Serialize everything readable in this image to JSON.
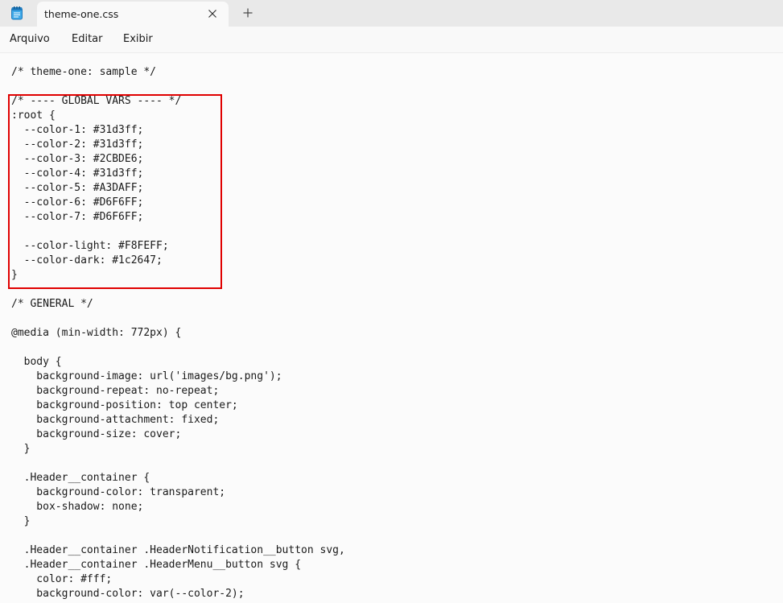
{
  "tab": {
    "title": "theme-one.css",
    "close_icon": "close-icon",
    "new_tab_icon": "plus-icon"
  },
  "app_icon": "notepad-icon",
  "menu": {
    "items": [
      "Arquivo",
      "Editar",
      "Exibir"
    ]
  },
  "highlight": {
    "color": "#e00000"
  },
  "code": {
    "lines": [
      "/* theme-one: sample */",
      "",
      "/* ---- GLOBAL VARS ---- */",
      ":root {",
      "  --color-1: #31d3ff;",
      "  --color-2: #31d3ff;",
      "  --color-3: #2CBDE6;",
      "  --color-4: #31d3ff;",
      "  --color-5: #A3DAFF;",
      "  --color-6: #D6F6FF;",
      "  --color-7: #D6F6FF;",
      "",
      "  --color-light: #F8FEFF;",
      "  --color-dark: #1c2647;",
      "}",
      "",
      "/* GENERAL */",
      "",
      "@media (min-width: 772px) {",
      "",
      "  body {",
      "    background-image: url('images/bg.png');",
      "    background-repeat: no-repeat;",
      "    background-position: top center;",
      "    background-attachment: fixed;",
      "    background-size: cover;",
      "  }",
      "",
      "  .Header__container {",
      "    background-color: transparent;",
      "    box-shadow: none;",
      "  }",
      "",
      "  .Header__container .HeaderNotification__button svg,",
      "  .Header__container .HeaderMenu__button svg {",
      "    color: #fff;",
      "    background-color: var(--color-2);"
    ]
  }
}
